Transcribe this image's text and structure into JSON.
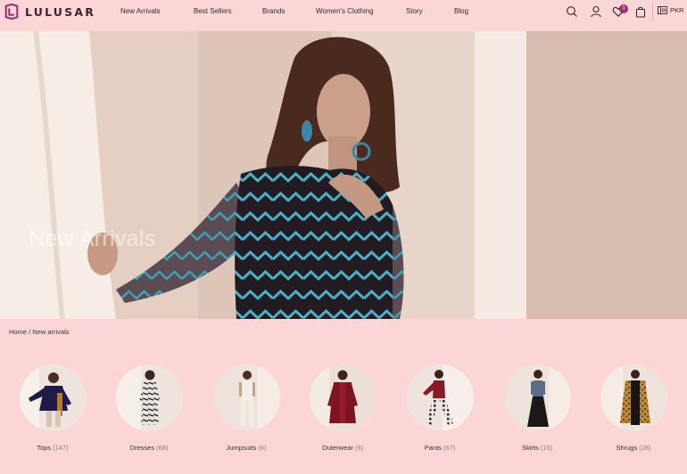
{
  "brand": {
    "name": "LULUSAR"
  },
  "nav": {
    "items": [
      {
        "label": "New Arrivals"
      },
      {
        "label": "Best Sellers"
      },
      {
        "label": "Brands"
      },
      {
        "label": "Women's Clothing"
      },
      {
        "label": "Story"
      },
      {
        "label": "Blog"
      }
    ]
  },
  "header_actions": {
    "icons": [
      "search-icon",
      "account-icon",
      "wishlist-icon",
      "bag-icon"
    ],
    "wishlist_count": "0",
    "currency": "PKR"
  },
  "hero": {
    "title": "New Arrivals"
  },
  "breadcrumb": {
    "home": "Home",
    "separator": " / ",
    "current": "New arrivals"
  },
  "categories": [
    {
      "label": "Tops",
      "count": "(147)"
    },
    {
      "label": "Dresses",
      "count": "(68)"
    },
    {
      "label": "Jumpsuits",
      "count": "(6)"
    },
    {
      "label": "Outerwear",
      "count": "(6)"
    },
    {
      "label": "Pants",
      "count": "(67)"
    },
    {
      "label": "Skirts",
      "count": "(15)"
    },
    {
      "label": "Shrugs",
      "count": "(28)"
    }
  ],
  "colors": {
    "page_background": "#fcd6d6",
    "accent": "#9c2a6a"
  }
}
